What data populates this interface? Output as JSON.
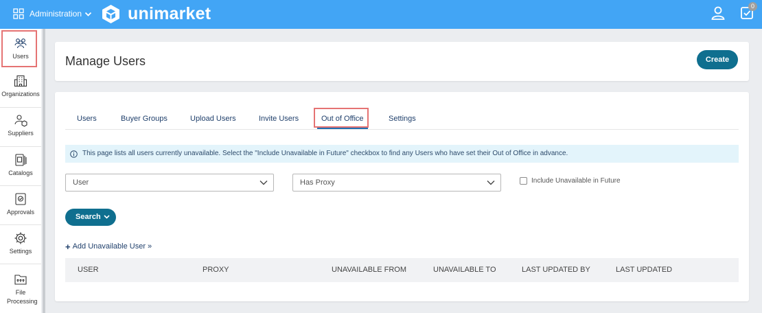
{
  "topbar": {
    "admin_label": "Administration",
    "logo_text": "unimarket",
    "tasks_badge": "0"
  },
  "sidebar": {
    "items": [
      {
        "label": "Users",
        "icon": "users-icon"
      },
      {
        "label": "Organizations",
        "icon": "building-icon"
      },
      {
        "label": "Suppliers",
        "icon": "supplier-icon"
      },
      {
        "label": "Catalogs",
        "icon": "catalog-icon"
      },
      {
        "label": "Approvals",
        "icon": "approval-icon"
      },
      {
        "label": "Settings",
        "icon": "gear-icon"
      },
      {
        "label": "File Processing",
        "icon": "file-processing-icon"
      }
    ]
  },
  "header": {
    "title": "Manage Users",
    "create_label": "Create"
  },
  "tabs": [
    "Users",
    "Buyer Groups",
    "Upload Users",
    "Invite Users",
    "Out of Office",
    "Settings"
  ],
  "active_tab": "Out of Office",
  "info": "This page lists all users currently unavailable. Select the \"Include Unavailable in Future\" checkbox to find any Users who have set their Out of Office in advance.",
  "filters": {
    "user_value": "User",
    "proxy_value": "Has Proxy",
    "future_label": "Include Unavailable in Future"
  },
  "search_label": "Search",
  "add_link": "Add Unavailable User »",
  "columns": [
    "USER",
    "PROXY",
    "UNAVAILABLE FROM",
    "UNAVAILABLE TO",
    "LAST UPDATED BY",
    "LAST UPDATED"
  ],
  "colors": {
    "topbar": "#42a5f5",
    "primary_button": "#0f6f8f",
    "highlight": "#e57373",
    "info_bg": "#e3f4fb"
  }
}
